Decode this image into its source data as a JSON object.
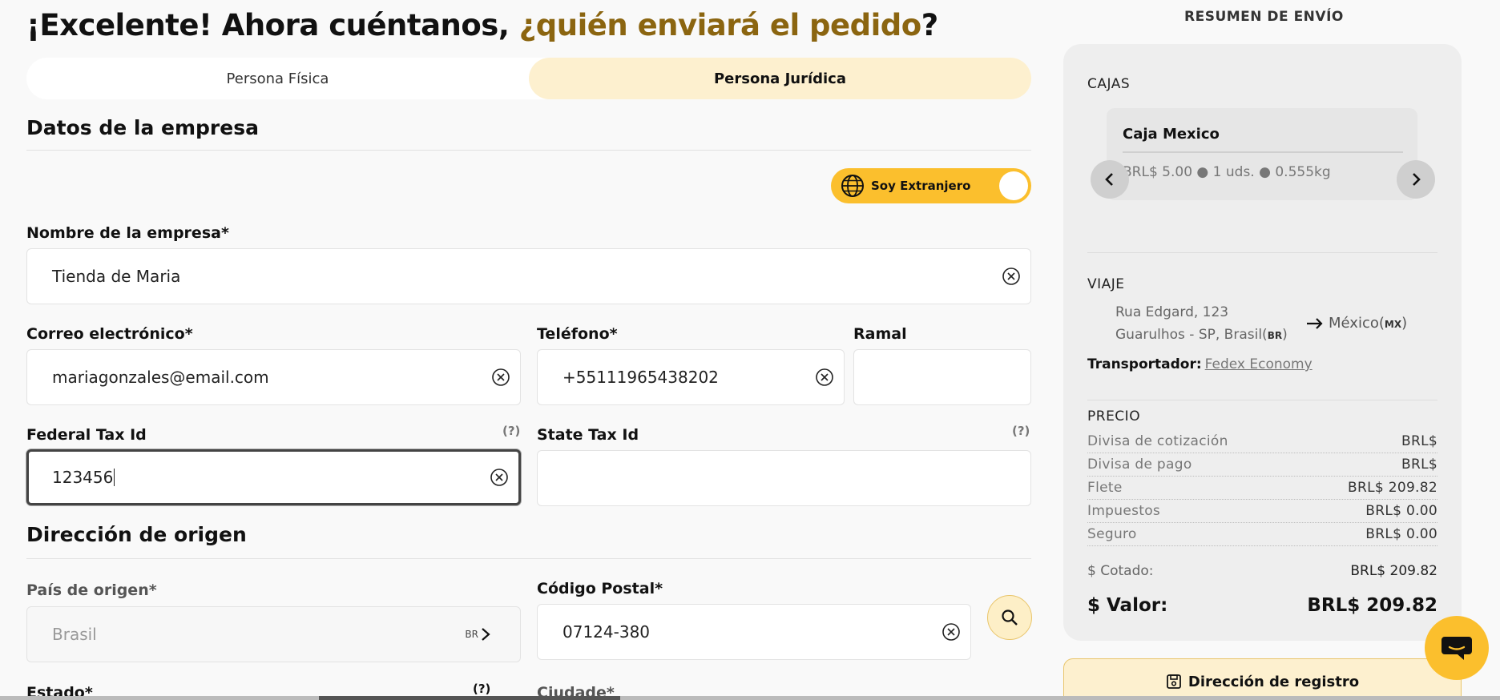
{
  "page": {
    "title_part1": "¡Excelente! Ahora cuéntanos, ",
    "title_accent": "¿quién enviará el pedido",
    "title_end": "?",
    "accent_color": "#8b6510"
  },
  "tabs": [
    {
      "label": "Persona Física",
      "active": false
    },
    {
      "label": "Persona Jurídica",
      "active": true
    }
  ],
  "company_section": {
    "title": "Datos de la empresa",
    "foreign_toggle_label": "Soy Extranjero",
    "company_name": {
      "label": "Nombre de la empresa*",
      "value": "Tienda de Maria"
    },
    "email": {
      "label": "Correo electrónico*",
      "value": "mariagonzales@email.com"
    },
    "phone": {
      "label": "Teléfono*",
      "value": "+55111965438202"
    },
    "extension": {
      "label": "Ramal",
      "value": ""
    },
    "federal_tax": {
      "label": "Federal Tax Id",
      "help": "(?)",
      "value": "123456"
    },
    "state_tax": {
      "label": "State Tax Id",
      "help": "(?)",
      "value": ""
    }
  },
  "origin_section": {
    "title": "Dirección de origen",
    "country": {
      "label": "País de origen*",
      "value": "Brasil",
      "code": "BR"
    },
    "postal": {
      "label": "Código Postal*",
      "value": "07124-380"
    },
    "state": {
      "label": "Estado*",
      "help": "(?)"
    },
    "city": {
      "label": "Ciudade*"
    }
  },
  "summary": {
    "heading": "RESUMEN DE ENVÍO",
    "boxes_label": "CAJAS",
    "box": {
      "name": "Caja Mexico",
      "meta": "BRL$ 5.00 ● 1 uds. ● 0.555kg"
    },
    "trip_label": "VIAJE",
    "origin_line1": "Rua Edgard, 123",
    "origin_line2": "Guarulhos - SP, Brasil(",
    "origin_code": "BR",
    "origin_close": ")",
    "destination": "México(",
    "destination_code": "MX",
    "destination_close": ")",
    "carrier_label": "Transportador:",
    "carrier_name": "Fedex Economy",
    "price_label": "PRECIO",
    "prices": [
      {
        "key": "Divisa de cotización",
        "value": "BRL$"
      },
      {
        "key": "Divisa de pago",
        "value": "BRL$"
      },
      {
        "key": "Flete",
        "value": "BRL$ 209.82"
      },
      {
        "key": "Impuestos",
        "value": "BRL$ 0.00"
      },
      {
        "key": "Seguro",
        "value": "BRL$ 0.00"
      }
    ],
    "quoted_label": "$ Cotado:",
    "quoted_value": "BRL$ 209.82",
    "total_label": "$ Valor:",
    "total_value": "BRL$ 209.82"
  },
  "register_button": "Dirección de registro",
  "colors": {
    "yellow": "#fbbf2d",
    "tab_active": "#fdf0cf"
  }
}
